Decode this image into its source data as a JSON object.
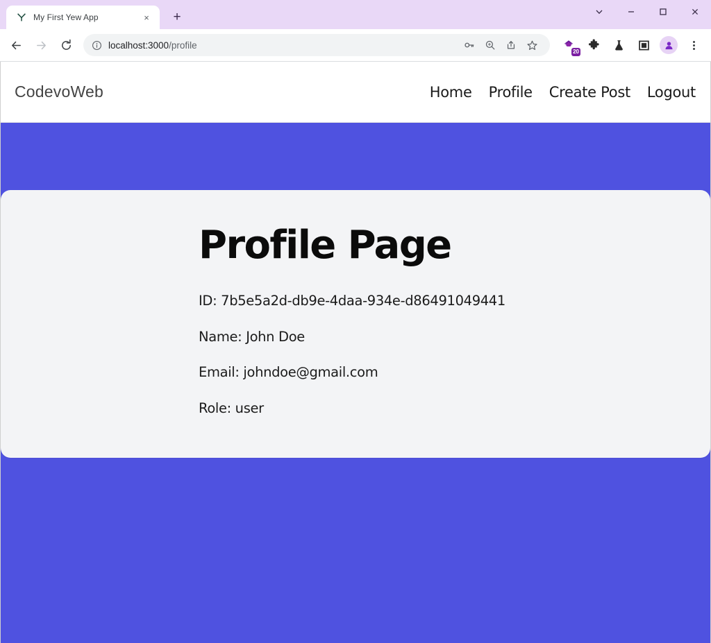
{
  "browser": {
    "tab": {
      "title": "My First Yew App",
      "favicon": "yew-logo-icon",
      "close_label": "×"
    },
    "new_tab_label": "+",
    "window_controls": {
      "tab_search": "tab-search-chevron-icon",
      "minimize": "minimize-icon",
      "maximize": "maximize-icon",
      "close": "close-icon"
    },
    "toolbar": {
      "back": "back-arrow-icon",
      "forward": "forward-arrow-icon",
      "reload": "reload-icon",
      "site_info": "info-circle-icon",
      "url_host": "localhost:3000",
      "url_path": "/profile",
      "url_full": "localhost:3000/profile",
      "actions": [
        {
          "name": "password-key-icon"
        },
        {
          "name": "zoom-search-icon"
        },
        {
          "name": "share-icon"
        },
        {
          "name": "bookmark-star-icon"
        }
      ],
      "extension_badge_count": "20",
      "extension_pin_icon": "purple-extension-icon",
      "puzzle_icon": "extensions-puzzle-icon",
      "flask_icon": "flask-experiments-icon",
      "split_icon": "split-screen-icon",
      "avatar_icon": "profile-avatar-icon",
      "menu_icon": "three-dot-menu-icon"
    }
  },
  "site": {
    "brand": "CodevoWeb",
    "nav": [
      {
        "label": "Home",
        "name": "nav-link-home"
      },
      {
        "label": "Profile",
        "name": "nav-link-profile"
      },
      {
        "label": "Create Post",
        "name": "nav-link-create-post"
      },
      {
        "label": "Logout",
        "name": "nav-link-logout"
      }
    ],
    "page": {
      "title": "Profile Page",
      "fields": [
        {
          "label": "ID",
          "value": "7b5e5a2d-db9e-4daa-934e-d86491049441",
          "text": "ID: 7b5e5a2d-db9e-4daa-934e-d86491049441"
        },
        {
          "label": "Name",
          "value": "John Doe",
          "text": "Name: John Doe"
        },
        {
          "label": "Email",
          "value": "johndoe@gmail.com",
          "text": "Email: johndoe@gmail.com"
        },
        {
          "label": "Role",
          "value": "user",
          "text": "Role: user"
        }
      ]
    }
  },
  "colors": {
    "page_background": "#4f52e0",
    "card_background": "#f3f4f6",
    "header_background": "#ffffff",
    "titlebar_background": "#e9d8f7",
    "accent_purple": "#7b1fa2"
  }
}
